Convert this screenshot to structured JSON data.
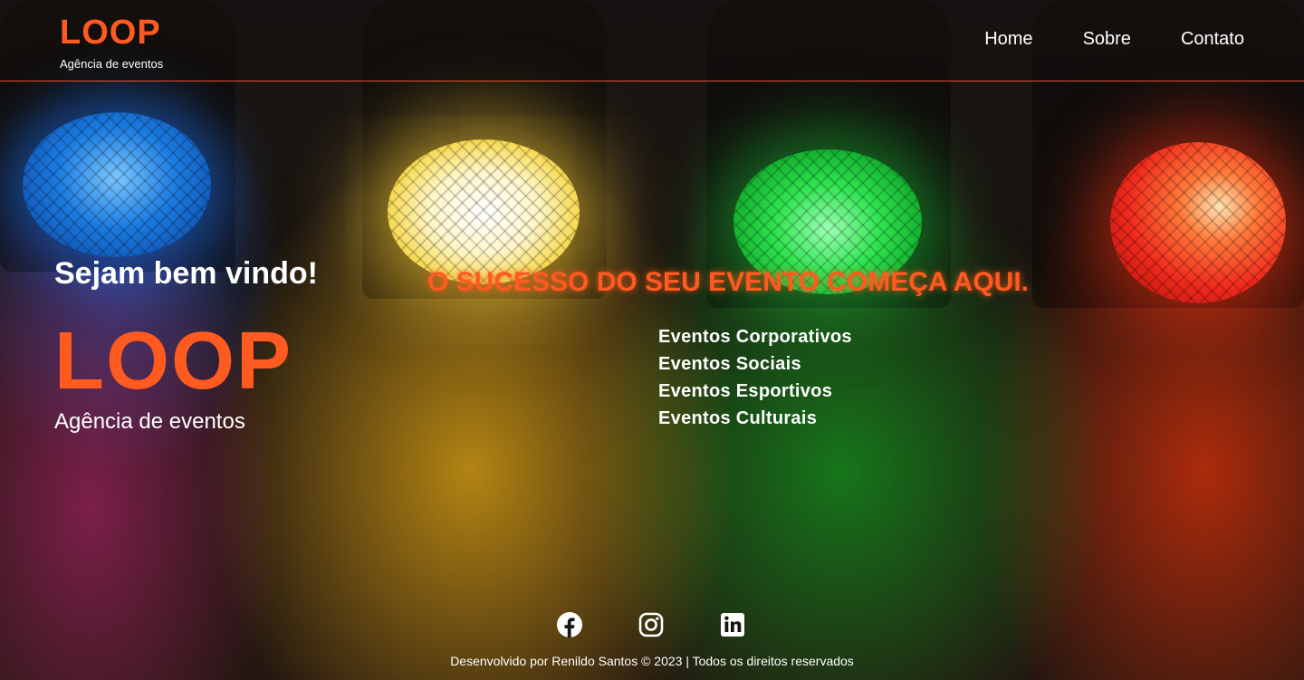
{
  "header": {
    "logo": "LOOP",
    "subtitle": "Agência de eventos",
    "nav": [
      {
        "label": "Home"
      },
      {
        "label": "Sobre"
      },
      {
        "label": "Contato"
      }
    ]
  },
  "hero": {
    "welcome": "Sejam bem vindo!",
    "logo": "LOOP",
    "subtitle": "Agência de eventos",
    "tagline": "O SUCESSO DO SEU EVENTO COMEÇA AQUI.",
    "services": [
      "Eventos Corporativos",
      "Eventos Sociais",
      "Eventos Esportivos",
      "Eventos Culturais"
    ]
  },
  "footer": {
    "social": [
      {
        "icon": "facebook-icon"
      },
      {
        "icon": "instagram-icon"
      },
      {
        "icon": "linkedin-icon"
      }
    ],
    "credits": "Desenvolvido por Renildo Santos © 2023 | Todos os direitos reservados"
  },
  "colors": {
    "accent": "#ff5a1f",
    "text": "#ffffff",
    "header_border": "#f0502a"
  }
}
